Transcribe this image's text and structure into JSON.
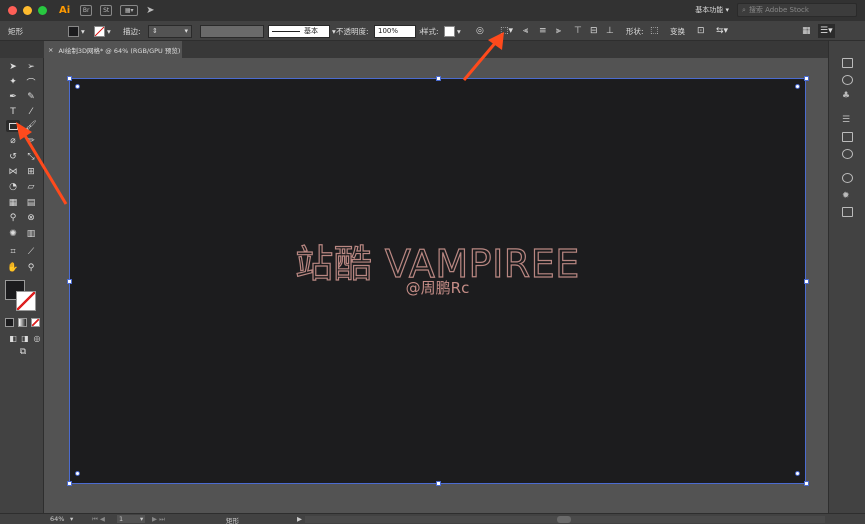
{
  "window": {
    "app_logo": "Ai",
    "bridge": "Br",
    "stock": "St",
    "workspace_label": "基本功能",
    "search_placeholder": "搜索 Adobe Stock"
  },
  "control_bar": {
    "object_type": "矩形",
    "stroke_label": "描边:",
    "brush_label": "基本",
    "opacity_label": "不透明度:",
    "opacity_value": "100%",
    "style_label": "样式:",
    "shape_label": "形状:",
    "transform_label": "变换"
  },
  "document": {
    "tab_title": "AI绘制3D网格* @ 64% (RGB/GPU 预览)",
    "close_glyph": "×"
  },
  "artboard": {
    "headline": "站酷 VAMPIREE",
    "byline": "@周鹏Rc"
  },
  "status_bar": {
    "zoom": "64%",
    "artboard_number": "1",
    "current_tool": "矩形"
  },
  "colors": {
    "accent_arrow": "#ff4a1c",
    "artboard_bg": "#1c1c1e",
    "headline_stroke": "#b98782",
    "selection": "#4b6bd0"
  },
  "icons": {
    "close": "close-icon",
    "search": "search-icon",
    "rectangle_tool": "rectangle-tool-icon"
  }
}
